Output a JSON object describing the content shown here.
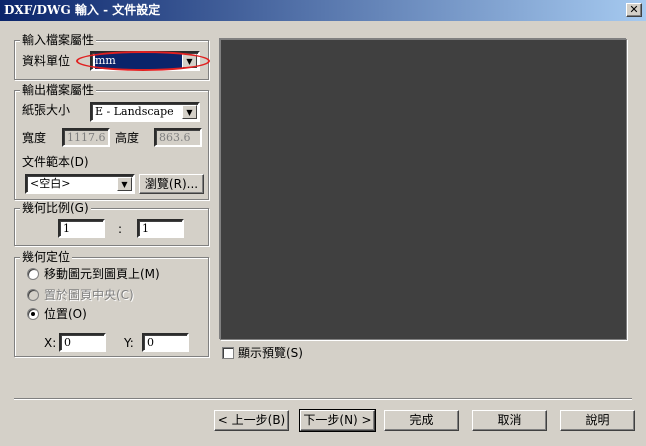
{
  "window": {
    "title": "DXF/DWG 輸入 - 文件設定",
    "close_glyph": "✕"
  },
  "input_props": {
    "legend": "輸入檔案屬性",
    "unit_label": "資料單位",
    "unit_value": "mm"
  },
  "output_props": {
    "legend": "輸出檔案屬性",
    "paper_size_label": "紙張大小",
    "paper_size_value": "E - Landscape",
    "width_label": "寬度",
    "width_value": "1117.6",
    "height_label": "高度",
    "height_value": "863.6",
    "template_label": "文件範本(D)",
    "template_value": "<空白>",
    "browse_label": "瀏覽(R)..."
  },
  "scale": {
    "legend": "幾何比例(G)",
    "left_value": "1",
    "separator": ":",
    "right_value": "1"
  },
  "positioning": {
    "legend": "幾何定位",
    "options": [
      {
        "label": "移動圖元到圖頁上(M)",
        "selected": false,
        "enabled": true
      },
      {
        "label": "置於圖頁中央(C)",
        "selected": false,
        "enabled": false
      },
      {
        "label": "位置(O)",
        "selected": true,
        "enabled": true
      }
    ],
    "x_label": "X:",
    "x_value": "0",
    "y_label": "Y:",
    "y_value": "0"
  },
  "preview": {
    "show_label": "顯示預覽(S)",
    "checked": false
  },
  "buttons": {
    "back": "< 上一步(B)",
    "next": "下一步(N) >",
    "finish": "完成",
    "cancel": "取消",
    "help": "說明"
  },
  "colors": {
    "dialog_bg": "#d4d0c8",
    "title_bar": "#0a246a",
    "preview_bg": "#404040",
    "highlight_ellipse": "#e02020"
  }
}
